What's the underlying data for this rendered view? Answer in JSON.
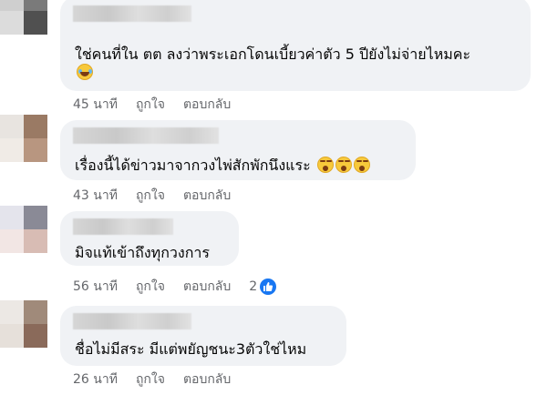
{
  "comments": [
    {
      "text": "ใช่คนที่ใน ตต ลงว่าพระเอกโดนเบี้ยวค่าตัว 5 ปียังไม่จ่ายไหมคะ",
      "emoji": "laughing-tears-icon",
      "time": "45 นาที",
      "like": "ถูกใจ",
      "reply": "ตอบกลับ"
    },
    {
      "text": "เรื่องนี้ได้ข่าวมาจากวงไพ่สักพักนึงแระ",
      "emoji": "yawn-icon",
      "time": "43 นาที",
      "like": "ถูกใจ",
      "reply": "ตอบกลับ"
    },
    {
      "text": "มิจแท้เข้าถึงทุกวงการ",
      "time": "56 นาที",
      "like": "ถูกใจ",
      "reply": "ตอบกลับ",
      "reaction_count": "2",
      "reaction_icon": "like-icon"
    },
    {
      "text": "ชื่อไม่มีสระ มีแต่พยัญชนะ3ตัวใช่ไหม",
      "time": "26 นาที",
      "like": "ถูกใจ",
      "reply": "ตอบกลับ"
    }
  ],
  "colors": {
    "bubble": "#f0f2f5",
    "meta_text": "#65676b",
    "like_blue": "#1877f2"
  }
}
